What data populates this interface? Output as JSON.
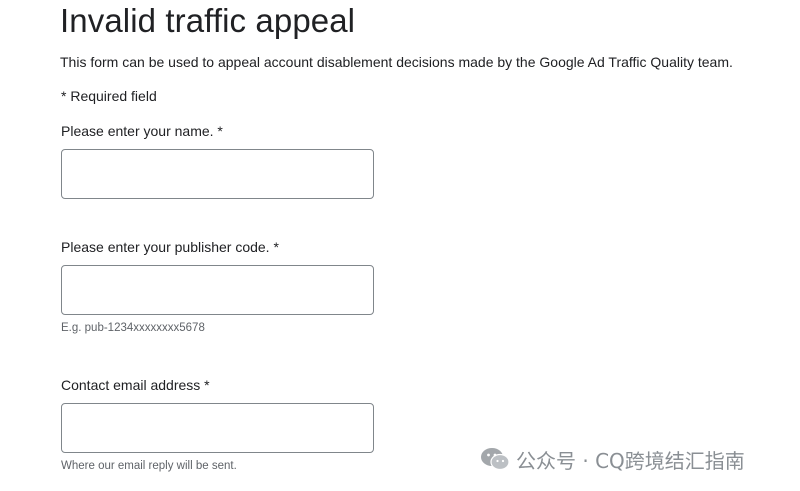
{
  "form": {
    "title": "Invalid traffic appeal",
    "intro": "This form can be used to appeal account disablement decisions made by the Google Ad Traffic Quality team.",
    "required_note": "* Required field",
    "fields": [
      {
        "label": "Please enter your name. *",
        "value": "",
        "hint": ""
      },
      {
        "label": "Please enter your publisher code. *",
        "value": "",
        "hint": "E.g. pub-1234xxxxxxxx5678"
      },
      {
        "label": "Contact email address *",
        "value": "",
        "hint": "Where our email reply will be sent."
      }
    ]
  },
  "watermark": {
    "text": "公众号 · CQ跨境结汇指南",
    "icon": "wechat-icon"
  }
}
